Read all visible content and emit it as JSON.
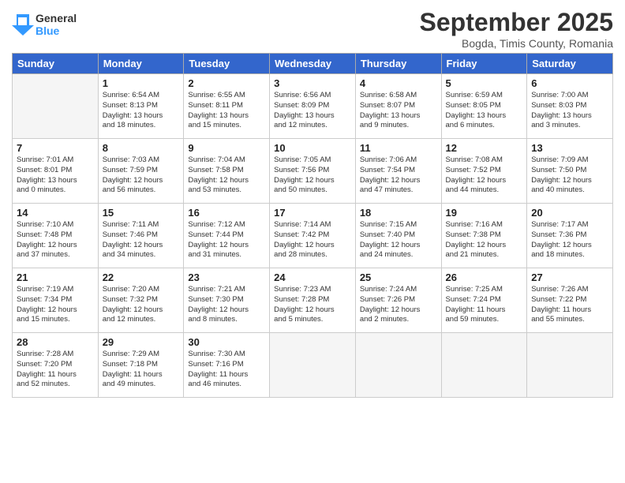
{
  "header": {
    "logo_general": "General",
    "logo_blue": "Blue",
    "month": "September 2025",
    "location": "Bogda, Timis County, Romania"
  },
  "weekdays": [
    "Sunday",
    "Monday",
    "Tuesday",
    "Wednesday",
    "Thursday",
    "Friday",
    "Saturday"
  ],
  "weeks": [
    [
      {
        "day": "",
        "info": ""
      },
      {
        "day": "1",
        "info": "Sunrise: 6:54 AM\nSunset: 8:13 PM\nDaylight: 13 hours\nand 18 minutes."
      },
      {
        "day": "2",
        "info": "Sunrise: 6:55 AM\nSunset: 8:11 PM\nDaylight: 13 hours\nand 15 minutes."
      },
      {
        "day": "3",
        "info": "Sunrise: 6:56 AM\nSunset: 8:09 PM\nDaylight: 13 hours\nand 12 minutes."
      },
      {
        "day": "4",
        "info": "Sunrise: 6:58 AM\nSunset: 8:07 PM\nDaylight: 13 hours\nand 9 minutes."
      },
      {
        "day": "5",
        "info": "Sunrise: 6:59 AM\nSunset: 8:05 PM\nDaylight: 13 hours\nand 6 minutes."
      },
      {
        "day": "6",
        "info": "Sunrise: 7:00 AM\nSunset: 8:03 PM\nDaylight: 13 hours\nand 3 minutes."
      }
    ],
    [
      {
        "day": "7",
        "info": "Sunrise: 7:01 AM\nSunset: 8:01 PM\nDaylight: 13 hours\nand 0 minutes."
      },
      {
        "day": "8",
        "info": "Sunrise: 7:03 AM\nSunset: 7:59 PM\nDaylight: 12 hours\nand 56 minutes."
      },
      {
        "day": "9",
        "info": "Sunrise: 7:04 AM\nSunset: 7:58 PM\nDaylight: 12 hours\nand 53 minutes."
      },
      {
        "day": "10",
        "info": "Sunrise: 7:05 AM\nSunset: 7:56 PM\nDaylight: 12 hours\nand 50 minutes."
      },
      {
        "day": "11",
        "info": "Sunrise: 7:06 AM\nSunset: 7:54 PM\nDaylight: 12 hours\nand 47 minutes."
      },
      {
        "day": "12",
        "info": "Sunrise: 7:08 AM\nSunset: 7:52 PM\nDaylight: 12 hours\nand 44 minutes."
      },
      {
        "day": "13",
        "info": "Sunrise: 7:09 AM\nSunset: 7:50 PM\nDaylight: 12 hours\nand 40 minutes."
      }
    ],
    [
      {
        "day": "14",
        "info": "Sunrise: 7:10 AM\nSunset: 7:48 PM\nDaylight: 12 hours\nand 37 minutes."
      },
      {
        "day": "15",
        "info": "Sunrise: 7:11 AM\nSunset: 7:46 PM\nDaylight: 12 hours\nand 34 minutes."
      },
      {
        "day": "16",
        "info": "Sunrise: 7:12 AM\nSunset: 7:44 PM\nDaylight: 12 hours\nand 31 minutes."
      },
      {
        "day": "17",
        "info": "Sunrise: 7:14 AM\nSunset: 7:42 PM\nDaylight: 12 hours\nand 28 minutes."
      },
      {
        "day": "18",
        "info": "Sunrise: 7:15 AM\nSunset: 7:40 PM\nDaylight: 12 hours\nand 24 minutes."
      },
      {
        "day": "19",
        "info": "Sunrise: 7:16 AM\nSunset: 7:38 PM\nDaylight: 12 hours\nand 21 minutes."
      },
      {
        "day": "20",
        "info": "Sunrise: 7:17 AM\nSunset: 7:36 PM\nDaylight: 12 hours\nand 18 minutes."
      }
    ],
    [
      {
        "day": "21",
        "info": "Sunrise: 7:19 AM\nSunset: 7:34 PM\nDaylight: 12 hours\nand 15 minutes."
      },
      {
        "day": "22",
        "info": "Sunrise: 7:20 AM\nSunset: 7:32 PM\nDaylight: 12 hours\nand 12 minutes."
      },
      {
        "day": "23",
        "info": "Sunrise: 7:21 AM\nSunset: 7:30 PM\nDaylight: 12 hours\nand 8 minutes."
      },
      {
        "day": "24",
        "info": "Sunrise: 7:23 AM\nSunset: 7:28 PM\nDaylight: 12 hours\nand 5 minutes."
      },
      {
        "day": "25",
        "info": "Sunrise: 7:24 AM\nSunset: 7:26 PM\nDaylight: 12 hours\nand 2 minutes."
      },
      {
        "day": "26",
        "info": "Sunrise: 7:25 AM\nSunset: 7:24 PM\nDaylight: 11 hours\nand 59 minutes."
      },
      {
        "day": "27",
        "info": "Sunrise: 7:26 AM\nSunset: 7:22 PM\nDaylight: 11 hours\nand 55 minutes."
      }
    ],
    [
      {
        "day": "28",
        "info": "Sunrise: 7:28 AM\nSunset: 7:20 PM\nDaylight: 11 hours\nand 52 minutes."
      },
      {
        "day": "29",
        "info": "Sunrise: 7:29 AM\nSunset: 7:18 PM\nDaylight: 11 hours\nand 49 minutes."
      },
      {
        "day": "30",
        "info": "Sunrise: 7:30 AM\nSunset: 7:16 PM\nDaylight: 11 hours\nand 46 minutes."
      },
      {
        "day": "",
        "info": ""
      },
      {
        "day": "",
        "info": ""
      },
      {
        "day": "",
        "info": ""
      },
      {
        "day": "",
        "info": ""
      }
    ]
  ]
}
